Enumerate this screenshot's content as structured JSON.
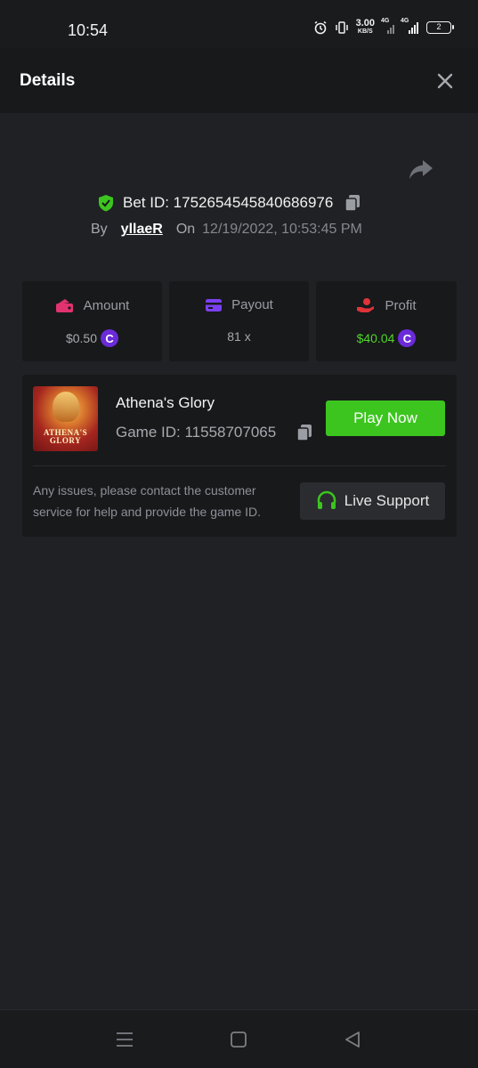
{
  "status_bar": {
    "time": "10:54",
    "net_speed_value": "3.00",
    "net_speed_unit": "KB/S",
    "sim1_label": "4G",
    "sim2_label": "4G",
    "battery_level": "2",
    "icons": [
      "alarm-icon",
      "vibrate-icon",
      "signal-icon",
      "battery-icon"
    ]
  },
  "header": {
    "title": "Details",
    "close_icon": "close-icon"
  },
  "bet": {
    "id_text": "Bet ID: 1752654545840686976",
    "by_label": "By",
    "username": "yllaeR",
    "on_label": "On",
    "datetime": "12/19/2022, 10:53:45 PM"
  },
  "stats": [
    {
      "label": "Amount",
      "value": "$0.50",
      "icon": "wallet-icon",
      "icon_color": "#e0336f",
      "has_coin": true,
      "value_color": "#a6a9ae"
    },
    {
      "label": "Payout",
      "value": "81 x",
      "icon": "card-icon",
      "icon_color": "#7b3ff2",
      "has_coin": false,
      "value_color": "#a6a9ae"
    },
    {
      "label": "Profit",
      "value": "$40.04",
      "icon": "hand-coin-icon",
      "icon_color": "#e0333a",
      "has_coin": true,
      "value_color": "#4fd62b"
    }
  ],
  "coin_symbol": "C",
  "game": {
    "thumb_text": "ATHENA'S GLORY",
    "name": "Athena's Glory",
    "id_text": "Game ID: 11558707065",
    "play_label": "Play Now",
    "support_text": "Any issues, please contact the customer service for help and provide the game ID.",
    "support_label": "Live Support"
  },
  "colors": {
    "accent_green": "#3cc51f",
    "background": "#202124",
    "card": "#18191b",
    "coin": "#6b2bd9"
  }
}
